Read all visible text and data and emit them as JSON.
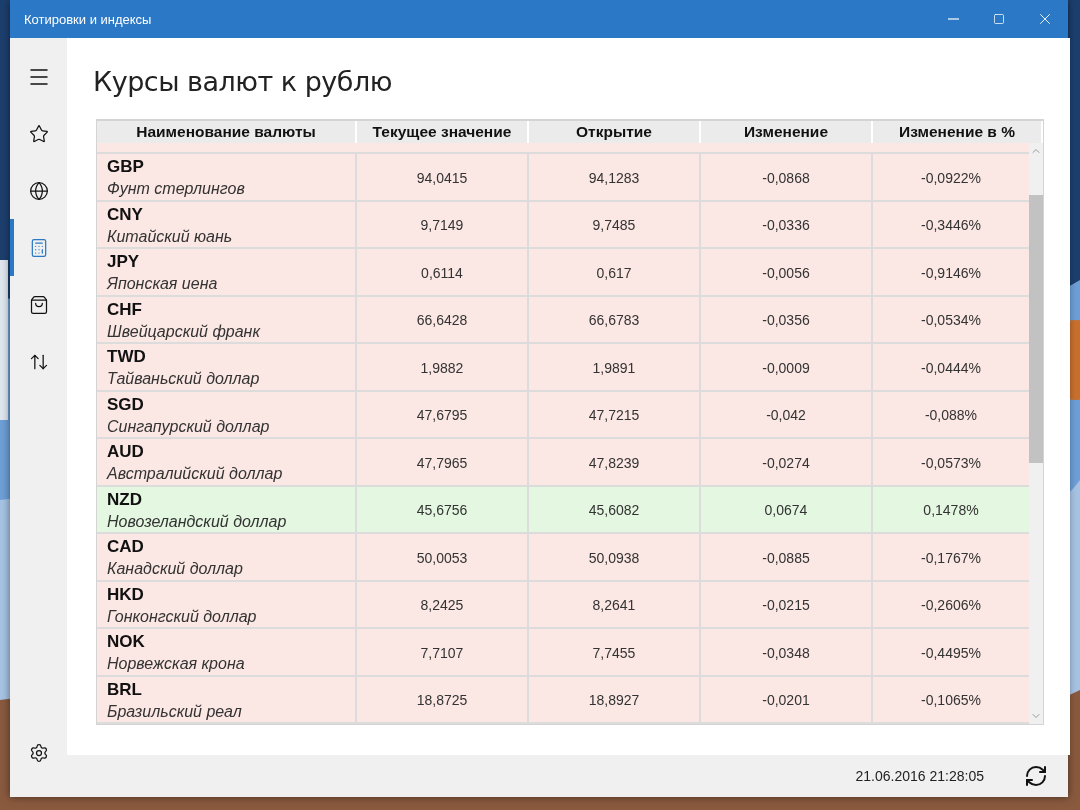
{
  "window": {
    "title": "Котировки и индексы"
  },
  "nav": [
    {
      "kind": "menu",
      "selected": false
    },
    {
      "kind": "star",
      "selected": false
    },
    {
      "kind": "globe",
      "selected": false
    },
    {
      "kind": "calculator",
      "selected": true
    },
    {
      "kind": "bag",
      "selected": false
    },
    {
      "kind": "updown",
      "selected": false
    }
  ],
  "nav_bottom": [
    {
      "kind": "settings",
      "selected": false
    }
  ],
  "page": {
    "title": "Курсы валют к рублю"
  },
  "table": {
    "columns": [
      "Наименование валюты",
      "Текущее значение",
      "Открытие",
      "Изменение",
      "Изменение в %"
    ],
    "rows": [
      {
        "code": "GBP",
        "name": "Фунт стерлингов",
        "current": "94,0415",
        "open": "94,1283",
        "change": "-0,0868",
        "change_pct": "-0,0922%",
        "kind": "down"
      },
      {
        "code": "CNY",
        "name": "Китайский юань",
        "current": "9,7149",
        "open": "9,7485",
        "change": "-0,0336",
        "change_pct": "-0,3446%",
        "kind": "down"
      },
      {
        "code": "JPY",
        "name": "Японская иена",
        "current": "0,6114",
        "open": "0,617",
        "change": "-0,0056",
        "change_pct": "-0,9146%",
        "kind": "down"
      },
      {
        "code": "CHF",
        "name": "Швейцарский франк",
        "current": "66,6428",
        "open": "66,6783",
        "change": "-0,0356",
        "change_pct": "-0,0534%",
        "kind": "down"
      },
      {
        "code": "TWD",
        "name": "Тайваньский доллар",
        "current": "1,9882",
        "open": "1,9891",
        "change": "-0,0009",
        "change_pct": "-0,0444%",
        "kind": "down"
      },
      {
        "code": "SGD",
        "name": "Сингапурский доллар",
        "current": "47,6795",
        "open": "47,7215",
        "change": "-0,042",
        "change_pct": "-0,088%",
        "kind": "down"
      },
      {
        "code": "AUD",
        "name": "Австралийский доллар",
        "current": "47,7965",
        "open": "47,8239",
        "change": "-0,0274",
        "change_pct": "-0,0573%",
        "kind": "down"
      },
      {
        "code": "NZD",
        "name": "Новозеландский доллар",
        "current": "45,6756",
        "open": "45,6082",
        "change": "0,0674",
        "change_pct": "0,1478%",
        "kind": "up"
      },
      {
        "code": "CAD",
        "name": "Канадский доллар",
        "current": "50,0053",
        "open": "50,0938",
        "change": "-0,0885",
        "change_pct": "-0,1767%",
        "kind": "down"
      },
      {
        "code": "HKD",
        "name": "Гонконгский доллар",
        "current": "8,2425",
        "open": "8,2641",
        "change": "-0,0215",
        "change_pct": "-0,2606%",
        "kind": "down"
      },
      {
        "code": "NOK",
        "name": "Норвежская крона",
        "current": "7,7107",
        "open": "7,7455",
        "change": "-0,0348",
        "change_pct": "-0,4495%",
        "kind": "down"
      },
      {
        "code": "BRL",
        "name": "Бразильский реал",
        "current": "18,8725",
        "open": "18,8927",
        "change": "-0,0201",
        "change_pct": "-0,1065%",
        "kind": "down"
      }
    ]
  },
  "status_bar": {
    "updated": "21.06.2016 21:28:05"
  }
}
